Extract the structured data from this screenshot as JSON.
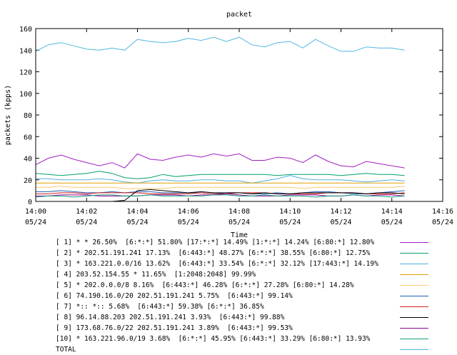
{
  "chart_data": {
    "type": "line",
    "title": "packet",
    "xlabel": "Time",
    "ylabel": "packets (kpps)",
    "ylim": [
      0,
      160
    ],
    "yticks": [
      "0",
      "20",
      "40",
      "60",
      "80",
      "100",
      "120",
      "140",
      "160"
    ],
    "xlim": [
      "14:00",
      "14:16"
    ],
    "xticks": [
      {
        "time": "14:00",
        "date": "05/24"
      },
      {
        "time": "14:02",
        "date": "05/24"
      },
      {
        "time": "14:04",
        "date": "05/24"
      },
      {
        "time": "14:06",
        "date": "05/24"
      },
      {
        "time": "14:08",
        "date": "05/24"
      },
      {
        "time": "14:10",
        "date": "05/24"
      },
      {
        "time": "14:12",
        "date": "05/24"
      },
      {
        "time": "14:14",
        "date": "05/24"
      },
      {
        "time": "14:16",
        "date": "05/24"
      }
    ],
    "x": [
      "14:00:00",
      "14:00:30",
      "14:01:00",
      "14:01:30",
      "14:02:00",
      "14:02:30",
      "14:03:00",
      "14:03:30",
      "14:04:00",
      "14:04:30",
      "14:05:00",
      "14:05:30",
      "14:06:00",
      "14:06:30",
      "14:07:00",
      "14:07:30",
      "14:08:00",
      "14:08:30",
      "14:09:00",
      "14:09:30",
      "14:10:00",
      "14:10:30",
      "14:11:00",
      "14:11:30",
      "14:12:00",
      "14:12:30",
      "14:13:00",
      "14:13:30",
      "14:14:00",
      "14:14:30"
    ],
    "series": [
      {
        "name": "[ 1] * * 26.50%  [6:*:*] 51.80% [17:*:*] 14.49% [1:*:*] 14.24% [6:80:*] 12.80%",
        "color": "#a020c0",
        "values": [
          34,
          40,
          43,
          39,
          36,
          33,
          36,
          31,
          44,
          39,
          38,
          41,
          43,
          41,
          44,
          42,
          44,
          38,
          38,
          41,
          40,
          36,
          43,
          37,
          33,
          32,
          37,
          35,
          33,
          31
        ]
      },
      {
        "name": "[ 2] * 202.51.191.241 17.13%  [6:443:*] 48.27% [6:*:*] 38.55% [6:80:*] 12.75%",
        "color": "#00a070",
        "values": [
          26,
          25,
          24,
          25,
          26,
          28,
          26,
          22,
          21,
          22,
          25,
          23,
          24,
          25,
          25,
          25,
          25,
          25,
          25,
          24,
          25,
          25,
          25,
          25,
          24,
          25,
          26,
          25,
          25,
          24
        ]
      },
      {
        "name": "[ 3] * 163.221.0.0/16 13.62%  [6:443:*] 33.54% [6:*:*] 32.12% [17:443:*] 14.19%",
        "color": "#50b0e0",
        "values": [
          21,
          21,
          20,
          20,
          20,
          21,
          20,
          18,
          17,
          19,
          20,
          19,
          19,
          20,
          20,
          19,
          19,
          17,
          19,
          21,
          24,
          21,
          20,
          20,
          20,
          19,
          18,
          19,
          20,
          19
        ]
      },
      {
        "name": "[ 4] 203.52.154.55 * 11.65%  [1:2048:2048] 99.99%",
        "color": "#e0a000",
        "values": [
          17,
          17,
          17,
          17,
          17,
          17,
          17,
          17,
          17,
          17,
          17,
          17,
          17,
          17,
          17,
          17,
          17,
          17,
          17,
          17,
          17,
          17,
          17,
          17,
          17,
          17,
          17,
          17,
          17,
          17
        ]
      },
      {
        "name": "[ 5] * 202.0.0.0/8 8.16%  [6:443:*] 46.28% [6:*:*] 27.28% [6:80:*] 14.28%",
        "color": "#ffc870",
        "values": [
          13,
          13,
          14,
          13,
          13,
          13,
          13,
          12,
          12,
          12,
          12,
          13,
          13,
          13,
          13,
          13,
          13,
          13,
          13,
          13,
          13,
          12,
          13,
          13,
          13,
          13,
          13,
          13,
          13,
          14
        ]
      },
      {
        "name": "[ 6] 74.190.16.0/20 202.51.191.241 5.75%  [6:443:*] 99.14%",
        "color": "#2060b0",
        "values": [
          9,
          9,
          10,
          9,
          8,
          8,
          9,
          8,
          9,
          9,
          8,
          8,
          8,
          8,
          7,
          8,
          8,
          7,
          7,
          8,
          7,
          8,
          9,
          9,
          8,
          7,
          7,
          8,
          9,
          10
        ]
      },
      {
        "name": "[ 7] *:: *:: 5.68%  [6:443:*] 59.38% [6:*:*] 36.85%",
        "color": "#d02020",
        "values": [
          7,
          7,
          8,
          8,
          7,
          8,
          8,
          8,
          8,
          7,
          7,
          7,
          7,
          8,
          7,
          7,
          8,
          8,
          8,
          7,
          7,
          7,
          7,
          8,
          8,
          8,
          7,
          7,
          7,
          8
        ]
      },
      {
        "name": "[ 8] 96.14.88.203 202.51.191.241 3.93%  [6:443:*] 99.88%",
        "color": "#000000",
        "values": [
          0,
          0,
          0,
          0,
          0,
          0,
          0,
          1,
          10,
          11,
          10,
          9,
          8,
          9,
          8,
          8,
          8,
          7,
          8,
          7,
          7,
          8,
          8,
          8,
          8,
          8,
          7,
          8,
          8,
          7
        ]
      },
      {
        "name": "[ 9] 173.68.76.0/22 202.51.191.241 3.89%  [6:443:*] 99.53%",
        "color": "#900090",
        "values": [
          5,
          5,
          6,
          6,
          6,
          5,
          5,
          5,
          5,
          6,
          6,
          6,
          5,
          6,
          6,
          7,
          6,
          5,
          5,
          5,
          6,
          6,
          6,
          5,
          5,
          6,
          5,
          6,
          6,
          5
        ]
      },
      {
        "name": "[10] * 163.221.96.0/19 3.68%  [6:*:*] 45.95% [6:443:*] 33.29% [6:80:*] 13.93%",
        "color": "#10a080",
        "values": [
          4,
          5,
          5,
          4,
          5,
          6,
          6,
          5,
          5,
          6,
          5,
          5,
          5,
          5,
          6,
          6,
          5,
          5,
          6,
          5,
          5,
          5,
          4,
          5,
          5,
          6,
          5,
          5,
          4,
          5
        ]
      },
      {
        "name": "TOTAL",
        "color": "#50b8e0",
        "values": [
          139,
          145,
          147,
          144,
          141,
          140,
          142,
          140,
          150,
          148,
          147,
          148,
          151,
          149,
          152,
          148,
          152,
          145,
          143,
          147,
          148,
          142,
          150,
          144,
          139,
          139,
          143,
          142,
          142,
          140
        ]
      }
    ],
    "grid": false,
    "legend": "bottom"
  }
}
